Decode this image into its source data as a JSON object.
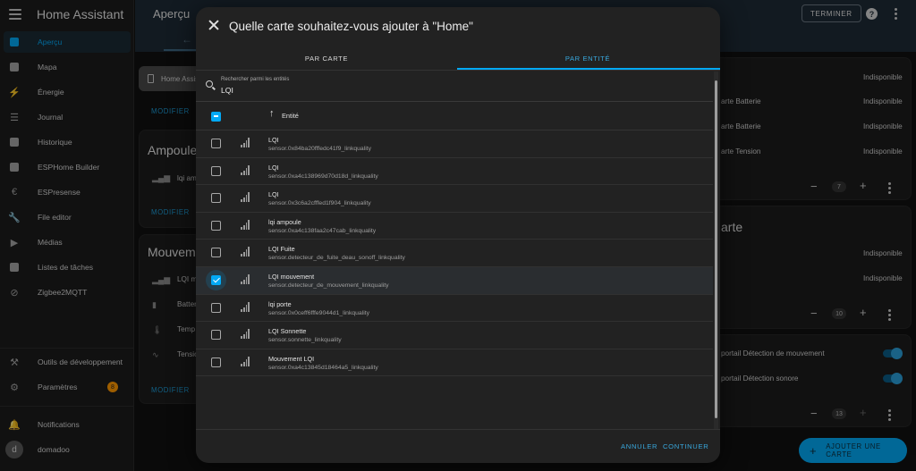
{
  "sidebar": {
    "app_title": "Home Assistant",
    "items": [
      {
        "label": "Aperçu",
        "icon": "dashboard-icon",
        "glyph": ""
      },
      {
        "label": "Mapa",
        "icon": "map-icon",
        "glyph": ""
      },
      {
        "label": "Énergie",
        "icon": "lightning-icon",
        "glyph": "⚡"
      },
      {
        "label": "Journal",
        "icon": "list-icon",
        "glyph": "☰"
      },
      {
        "label": "Historique",
        "icon": "chart-icon",
        "glyph": ""
      },
      {
        "label": "ESPHome Builder",
        "icon": "esphome-icon",
        "glyph": ""
      },
      {
        "label": "ESPresense",
        "icon": "espresense-icon",
        "glyph": "€"
      },
      {
        "label": "File editor",
        "icon": "wrench-icon",
        "glyph": "🔧"
      },
      {
        "label": "Médias",
        "icon": "media-icon",
        "glyph": "▶"
      },
      {
        "label": "Listes de tâches",
        "icon": "clipboard-icon",
        "glyph": ""
      },
      {
        "label": "Zigbee2MQTT",
        "icon": "zigbee-icon",
        "glyph": "⊘"
      }
    ],
    "dev_tools": "Outils de développement",
    "settings": "Paramètres",
    "settings_badge": "8",
    "notifications": "Notifications",
    "user_name": "domadoo",
    "user_initial": "d"
  },
  "topbar": {
    "title": "Aperçu",
    "done_button": "TERMINER",
    "help": "?"
  },
  "background": {
    "chip_label": "Home Assist",
    "modifier": "MODIFIER",
    "ampoule_heading": "Ampoule",
    "ampoule_row": "lqi am",
    "mouvement_heading": "Mouvem",
    "mouvement_rows": [
      "LQI m",
      "Batter",
      "Temp",
      "Tensio"
    ],
    "right_rows": [
      {
        "label": "",
        "value": "Indisponible"
      },
      {
        "label": "arte Batterie",
        "value": "Indisponible"
      },
      {
        "label": "arte Batterie",
        "value": "Indisponible"
      },
      {
        "label": "arte Tension",
        "value": "Indisponible"
      }
    ],
    "right_heading": "arte",
    "right_rows2": [
      {
        "value": "Indisponible"
      },
      {
        "value": "Indisponible"
      }
    ],
    "toggle_rows": [
      "portail Détection de mouvement",
      "portail Détection sonore"
    ],
    "counts": [
      "7",
      "10",
      "13"
    ],
    "add_card": "AJOUTER UNE CARTE"
  },
  "dialog": {
    "title": "Quelle carte souhaitez-vous ajouter à \"Home\"",
    "tabs": [
      "PAR CARTE",
      "PAR ENTITÉ"
    ],
    "search_placeholder": "Rechercher parmi les entités",
    "search_value": "LQI",
    "column_header": "Entité",
    "rows": [
      {
        "name": "LQI",
        "entity_id": "sensor.0x84ba20fffedc41f9_linkquality",
        "selected": false
      },
      {
        "name": "LQI",
        "entity_id": "sensor.0xa4c138969d70d18d_linkquality",
        "selected": false
      },
      {
        "name": "LQI",
        "entity_id": "sensor.0x3c6a2cfffed1f904_linkquality",
        "selected": false
      },
      {
        "name": "lqi ampoule",
        "entity_id": "sensor.0xa4c138faa2c47cab_linkquality",
        "selected": false
      },
      {
        "name": "LQI Fuite",
        "entity_id": "sensor.detecteur_de_fuite_deau_sonoff_linkquality",
        "selected": false
      },
      {
        "name": "LQI mouvement",
        "entity_id": "sensor.detecteur_de_mouvement_linkquality",
        "selected": true
      },
      {
        "name": "lqi porte",
        "entity_id": "sensor.0x0ceff6fffe9044d1_linkquality",
        "selected": false
      },
      {
        "name": "LQI Sonnette",
        "entity_id": "sensor.sonnette_linkquality",
        "selected": false
      },
      {
        "name": "Mouvement LQI",
        "entity_id": "sensor.0xa4c13845d18464a5_linkquality",
        "selected": false
      }
    ],
    "cancel": "ANNULER",
    "continue": "CONTINUER"
  },
  "colors": {
    "accent": "#03a9f4",
    "topbar": "#1e2b36",
    "dialog": "#222222"
  }
}
